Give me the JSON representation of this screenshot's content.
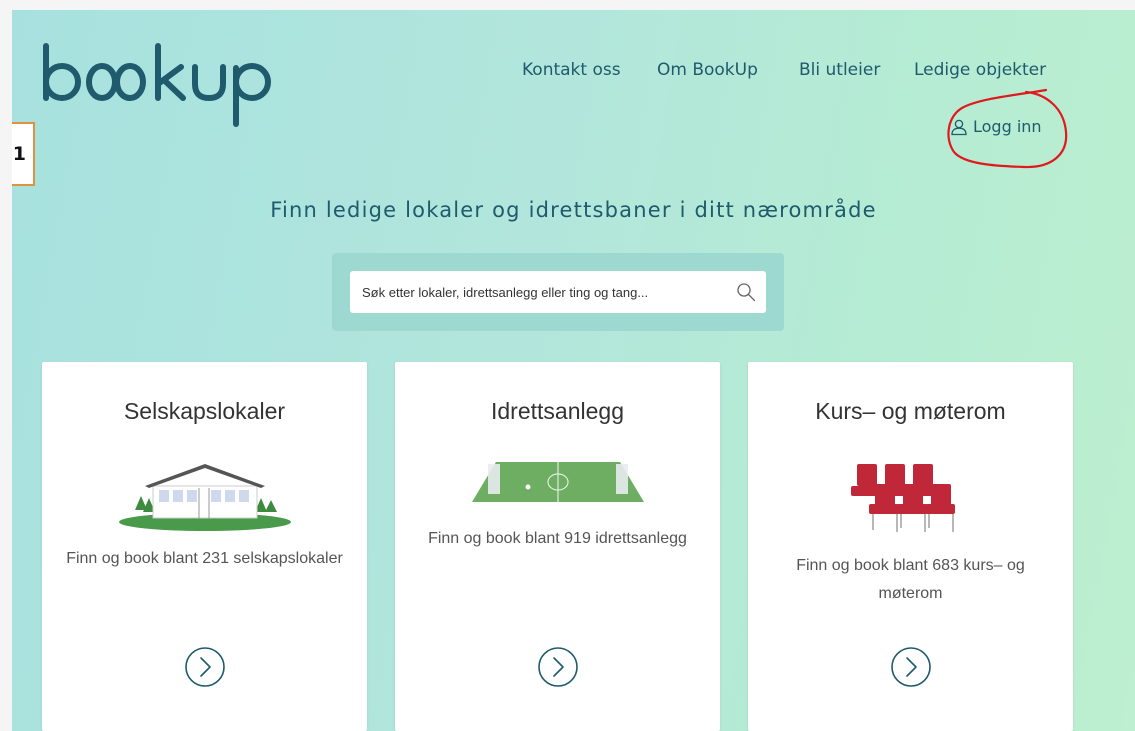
{
  "brand": {
    "logo_text": "bookup",
    "color": "#1f5a6d"
  },
  "side_marker": "1",
  "nav": {
    "items": [
      {
        "label": "Kontakt oss"
      },
      {
        "label": "Om BookUp"
      },
      {
        "label": "Bli utleier"
      },
      {
        "label": "Ledige objekter"
      }
    ],
    "login_label": "Logg inn"
  },
  "hero": {
    "tagline": "Finn ledige lokaler og idrettsbaner i ditt nærområde"
  },
  "search": {
    "placeholder": "Søk etter lokaler, idrettsanlegg eller ting og tang..."
  },
  "cards": [
    {
      "title": "Selskapslokaler",
      "text": "Finn og book blant 231 selskapslokaler",
      "icon": "party-venue-icon"
    },
    {
      "title": "Idrettsanlegg",
      "text": "Finn og book blant 919 idrettsanlegg",
      "icon": "football-field-icon"
    },
    {
      "title": "Kurs– og møterom",
      "text": "Finn og book blant 683 kurs– og møterom",
      "icon": "chairs-icon"
    }
  ],
  "colors": {
    "accent": "#1f5a6d",
    "annotation": "#e0191f",
    "marker_border": "#e2913f"
  }
}
